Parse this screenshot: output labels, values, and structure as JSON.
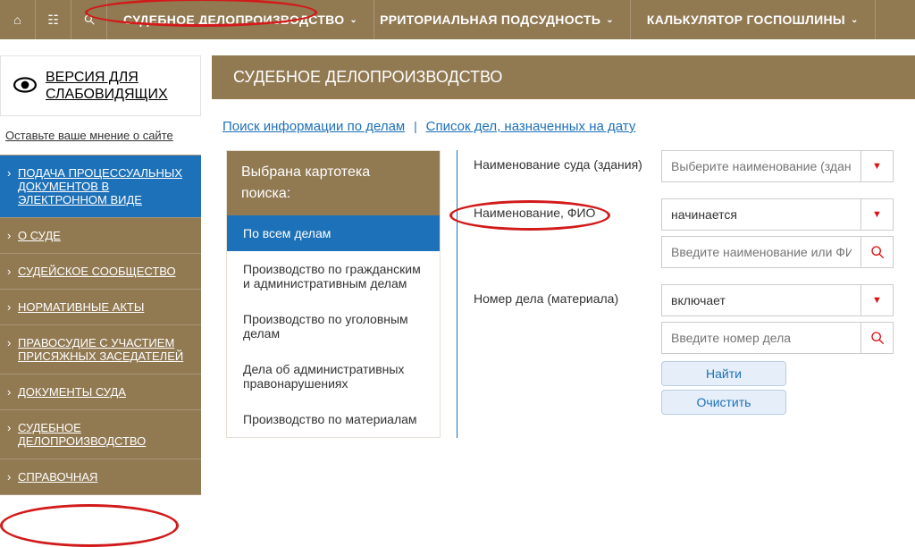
{
  "topnav": {
    "items": [
      {
        "label": "СУДЕБНОЕ ДЕЛОПРОИЗВОДСТВО"
      },
      {
        "label_partial": "РРИТОРИАЛЬНАЯ ПОДСУДНОСТЬ"
      },
      {
        "label": "КАЛЬКУЛЯТОР ГОСПОШЛИНЫ"
      }
    ]
  },
  "accessibility": {
    "line1": "ВЕРСИЯ ДЛЯ",
    "line2": "СЛАБОВИДЯЩИХ"
  },
  "feedback_link": "Оставьте ваше мнение о сайте",
  "sidebar": {
    "items": [
      {
        "label": "ПОДАЧА ПРОЦЕССУАЛЬНЫХ ДОКУМЕНТОВ В ЭЛЕКТРОННОМ ВИДЕ",
        "highlight": true
      },
      {
        "label": "О СУДЕ"
      },
      {
        "label": "СУДЕЙСКОЕ СООБЩЕСТВО"
      },
      {
        "label": "НОРМАТИВНЫЕ АКТЫ"
      },
      {
        "label": "ПРАВОСУДИЕ С УЧАСТИЕМ ПРИСЯЖНЫХ ЗАСЕДАТЕЛЕЙ"
      },
      {
        "label": "ДОКУМЕНТЫ СУДА"
      },
      {
        "label": "СУДЕБНОЕ ДЕЛОПРОИЗВОДСТВО"
      },
      {
        "label": "СПРАВОЧНАЯ"
      }
    ]
  },
  "page_title": "СУДЕБНОЕ ДЕЛОПРОИЗВОДСТВО",
  "links_row": {
    "search_cases": "Поиск информации по делам",
    "list_by_date": "Список дел, назначенных на дату"
  },
  "card_index": {
    "heading_l1": "Выбрана картотека",
    "heading_l2": "поиска:",
    "items": [
      "По всем делам",
      "Производство по гражданским и административным делам",
      "Производство по уголовным делам",
      "Дела об административных правонарушениях",
      "Производство по материалам"
    ]
  },
  "fields": {
    "court_name": {
      "label": "Наименование суда (здания)",
      "placeholder": "Выберите наименование (здание) су"
    },
    "party_name": {
      "label": "Наименование, ФИО",
      "match_mode": "начинается",
      "placeholder": "Введите наименование или ФИО"
    },
    "case_number": {
      "label": "Номер дела (материала)",
      "match_mode": "включает",
      "placeholder": "Введите номер дела"
    }
  },
  "buttons": {
    "find": "Найти",
    "clear": "Очистить"
  }
}
